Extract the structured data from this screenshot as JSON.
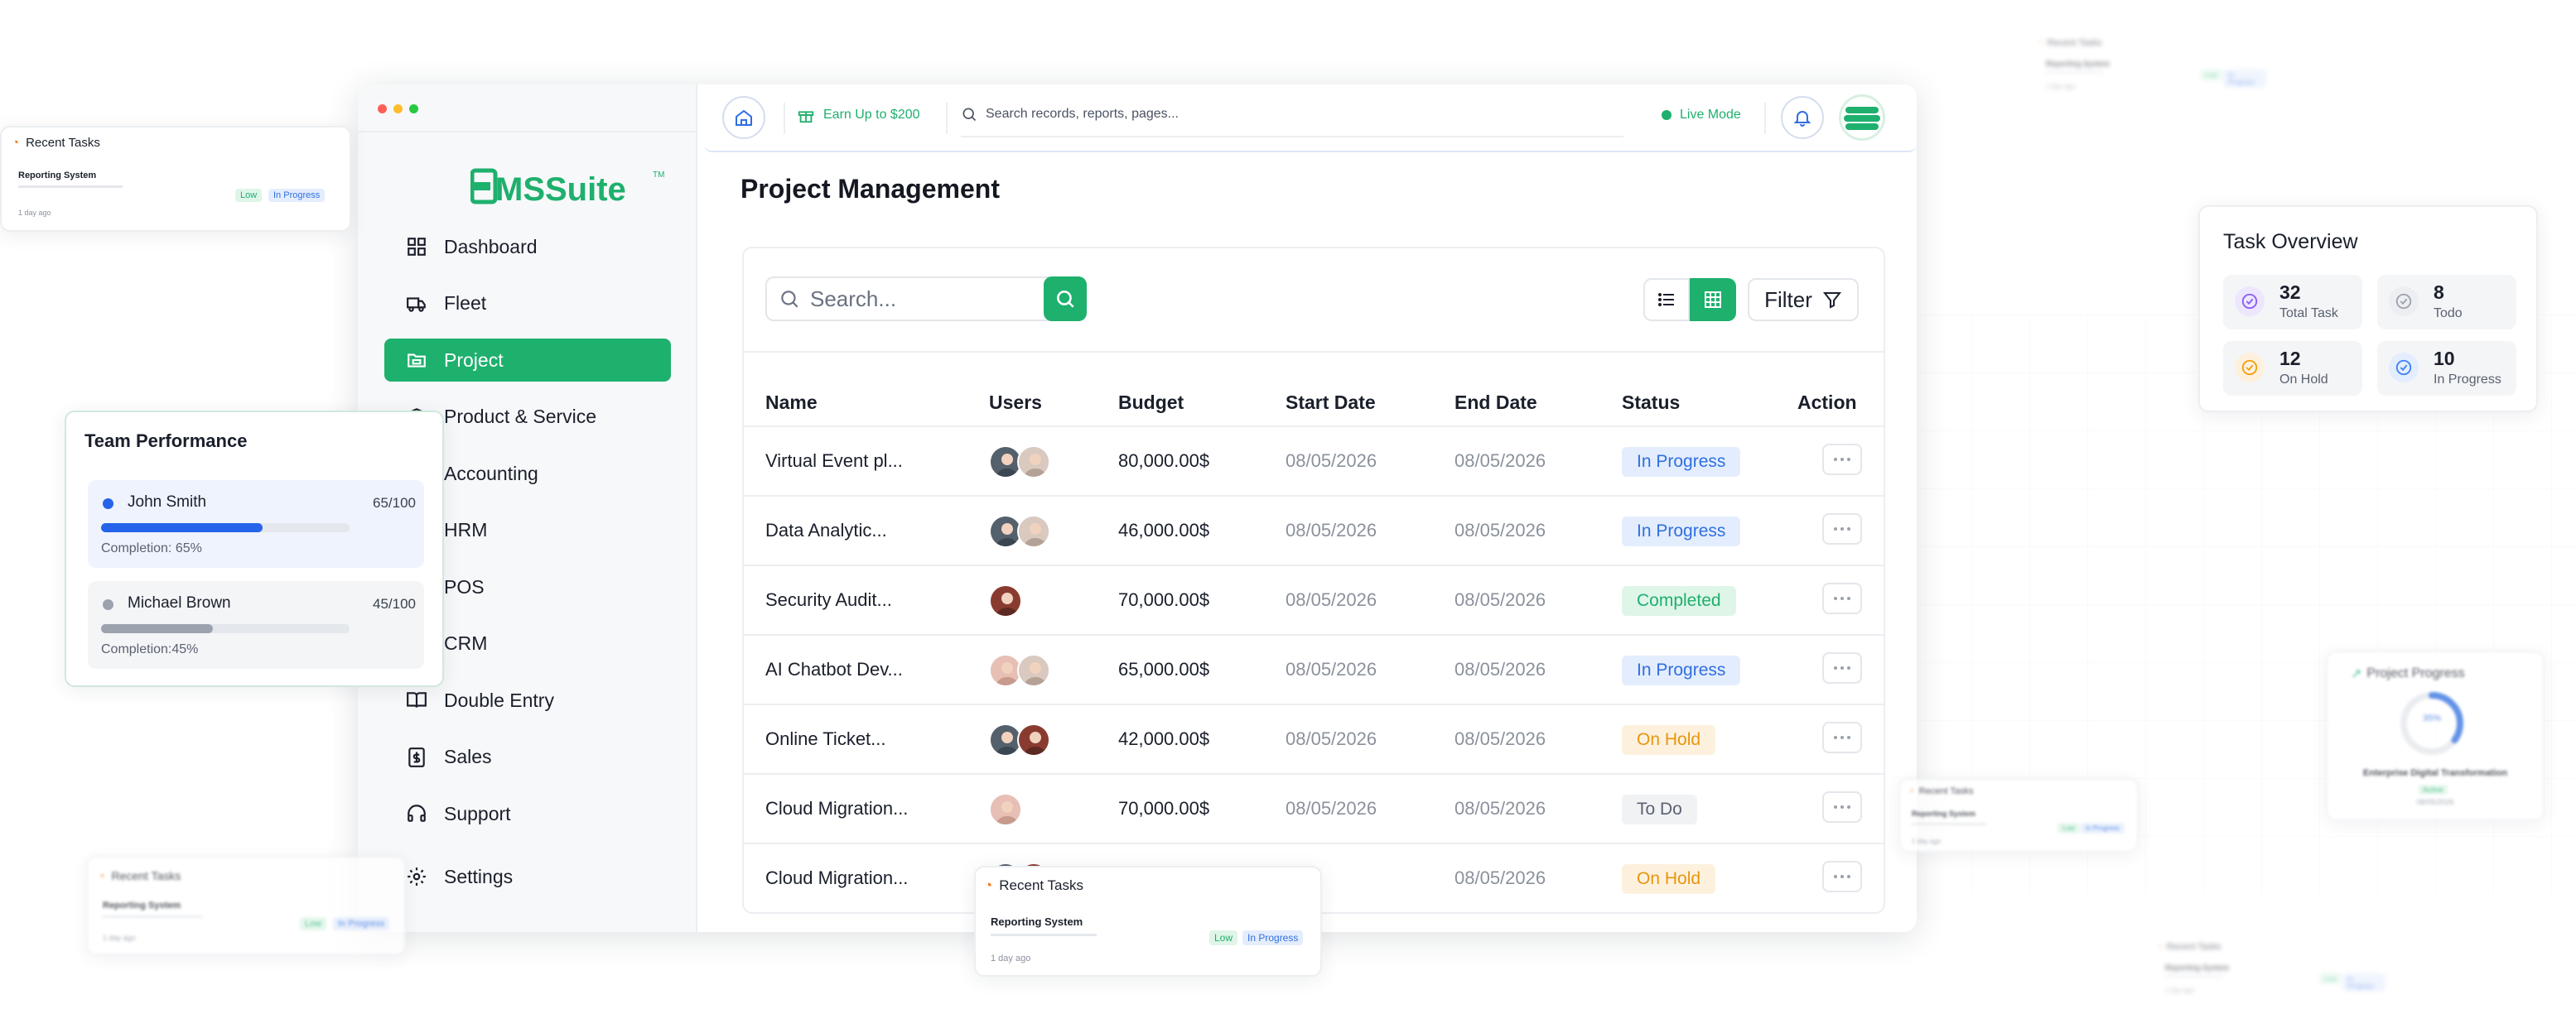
{
  "window": {
    "dots": [
      "#ff5f57",
      "#febc2e",
      "#28c840"
    ],
    "logo": {
      "text": "EMSSuite",
      "tm": "TM"
    }
  },
  "sidebar": {
    "items": [
      {
        "label": "Dashboard",
        "icon": "grid-icon"
      },
      {
        "label": "Fleet",
        "icon": "truck-icon"
      },
      {
        "label": "Project",
        "icon": "folder-icon",
        "active": true
      },
      {
        "label": "Product & Service",
        "icon": "box-icon"
      },
      {
        "label": "Accounting",
        "icon": "calculator-icon"
      },
      {
        "label": "HRM",
        "icon": "users-icon"
      },
      {
        "label": "POS",
        "icon": "cart-icon"
      },
      {
        "label": "CRM",
        "icon": "contact-icon"
      },
      {
        "label": "Double Entry",
        "icon": "book-icon"
      },
      {
        "label": "Sales",
        "icon": "dollar-icon"
      },
      {
        "label": "Support",
        "icon": "headset-icon"
      },
      {
        "label": "Settings",
        "icon": "gear-icon"
      }
    ]
  },
  "topbar": {
    "earn": "Earn Up to $200",
    "search_placeholder": "Search records, reports, pages...",
    "live_mode": "Live Mode"
  },
  "page": {
    "title": "Project Management"
  },
  "table_toolbar": {
    "search_placeholder": "Search...",
    "filter_label": "Filter"
  },
  "table": {
    "columns": [
      "Name",
      "Users",
      "Budget",
      "Start Date",
      "End Date",
      "Status",
      "Action"
    ],
    "rows": [
      {
        "name": "Virtual Event pl...",
        "users": [
          "m1",
          "m2"
        ],
        "budget": "80,000.00$",
        "start": "08/05/2026",
        "end": "08/05/2026",
        "status": "In Progress"
      },
      {
        "name": "Data Analytic...",
        "users": [
          "m1",
          "m2"
        ],
        "budget": "46,000.00$",
        "start": "08/05/2026",
        "end": "08/05/2026",
        "status": "In Progress"
      },
      {
        "name": "Security Audit...",
        "users": [
          "f1"
        ],
        "budget": "70,000.00$",
        "start": "08/05/2026",
        "end": "08/05/2026",
        "status": "Completed"
      },
      {
        "name": "AI Chatbot Dev...",
        "users": [
          "f2",
          "m2"
        ],
        "budget": "65,000.00$",
        "start": "08/05/2026",
        "end": "08/05/2026",
        "status": "In Progress"
      },
      {
        "name": "Online Ticket...",
        "users": [
          "m1",
          "f1"
        ],
        "budget": "42,000.00$",
        "start": "08/05/2026",
        "end": "08/05/2026",
        "status": "On Hold"
      },
      {
        "name": "Cloud Migration...",
        "users": [
          "f2"
        ],
        "budget": "70,000.00$",
        "start": "08/05/2026",
        "end": "08/05/2026",
        "status": "To Do"
      },
      {
        "name": "Cloud Migration...",
        "users": [
          "m1",
          "f1"
        ],
        "budget": "",
        "start": "",
        "end": "08/05/2026",
        "status": "On Hold"
      }
    ],
    "status_colors": {
      "In Progress": {
        "bg": "#e4edfd",
        "fg": "#2f6fe0"
      },
      "Completed": {
        "bg": "#dff5e8",
        "fg": "#1eb06d"
      },
      "On Hold": {
        "bg": "#fdf1de",
        "fg": "#e8950f"
      },
      "To Do": {
        "bg": "#f1f2f4",
        "fg": "#5a6170"
      }
    }
  },
  "team_performance": {
    "title": "Team Performance",
    "members": [
      {
        "name": "John Smith",
        "score": "65/100",
        "completion_text": "Completion: 65%",
        "completion": 0.65,
        "color": "#2563eb"
      },
      {
        "name": "Michael Brown",
        "score": "45/100",
        "completion_text": "Completion:45%",
        "completion": 0.45,
        "color": "#9ca3af"
      }
    ]
  },
  "task_overview": {
    "title": "Task Overview",
    "stats": [
      {
        "value": "32",
        "label": "Total Task",
        "color": "#8b5cf6"
      },
      {
        "value": "8",
        "label": "Todo",
        "color": "#9ca3af"
      },
      {
        "value": "12",
        "label": "On Hold",
        "color": "#f59e0b"
      },
      {
        "value": "10",
        "label": "In Progress",
        "color": "#3b82f6"
      }
    ]
  },
  "recent_tasks": {
    "title": "Recent Tasks",
    "task": "Reporting System",
    "priority": "Low",
    "status": "In Progress",
    "age": "1 day ago",
    "age_short": "1 day ago"
  },
  "project_progress": {
    "title": "Project Progress",
    "percent": "35%",
    "project": "Enterprise Digital Transformation",
    "badge": "Active",
    "date": "08/05/2026"
  }
}
